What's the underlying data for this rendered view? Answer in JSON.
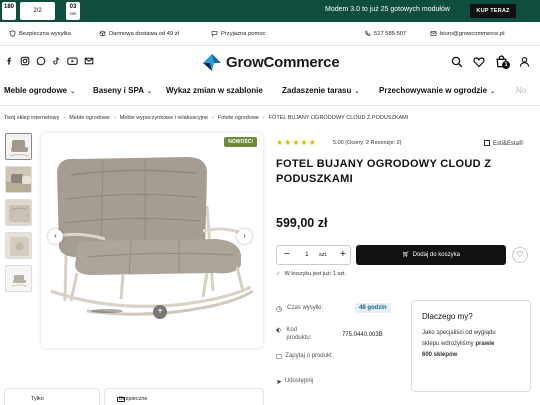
{
  "promo": {
    "countdown": [
      {
        "value": "180",
        "unit": "days"
      },
      {
        "value": "2/2",
        "unit": ""
      },
      {
        "value": "03",
        "unit": "sek"
      }
    ],
    "text": "Modem 3.0 to już 25 gotowych modułów",
    "button": "KUP TERAZ"
  },
  "info_bar": {
    "items": [
      "Bezpieczna wysyłka",
      "Darmowa dostawa od 49 zł",
      "Przyjazna pomoc"
    ],
    "phone": "517 585 507",
    "email": "biuro@growcommerce.pl"
  },
  "header": {
    "logo": "GrowCommerce",
    "cart_count": "1"
  },
  "nav": {
    "items": [
      "Meble ogrodowe",
      "Baseny i SPA",
      "Wykaz zmian w szablonie",
      "Zadaszenie tarasu",
      "Przechowywanie w ogrodzie",
      "No"
    ]
  },
  "breadcrumb": [
    "Twój sklep internetowy",
    "Meble ogrodowe",
    "Meble wypoczynkowe i relaksacyjne",
    "Fotele ogrodowe",
    "FOTEL BUJANY OGRODOWY CLOUD Z PODUSZKAMI"
  ],
  "gallery": {
    "badge": "NOWOŚĆ!"
  },
  "product": {
    "rating_text": "5.00 (Oceny: 2 Recenzje: 2)",
    "brand": "Esti&Esta®",
    "title": "FOTEL BUJANY OGRODOWY CLOUD Z PODUSZKAMI",
    "price": "599,00 zł",
    "qty_value": "1",
    "qty_unit": "szt.",
    "add_to_cart": "Dodaj do koszyka",
    "in_cart": "W koszyku jest już: 1 szt.",
    "details": {
      "shipping_label": "Czas wysyłki:",
      "shipping_value": "48 godzin",
      "code_label_1": "Kod",
      "code_label_2": "produktu:",
      "code_value": "775.0440.003B",
      "ask": "Zapytaj o produkt",
      "share": "Udostępnij"
    },
    "why": {
      "title": "Dlaczego my?",
      "text_1": "Jako specjaliści od wyglądu",
      "text_2": "sklepu wdrożyliśmy",
      "text_bold_1": "prawie",
      "text_bold_2": "600 sklepów"
    }
  },
  "bottom": {
    "left_label": "Tylko",
    "right_label": "Bezpieczne"
  },
  "colors": {
    "promo_bg": "#0f4d3f",
    "badge": "#6f8a3a",
    "star": "#e6b400",
    "button": "#111111"
  }
}
